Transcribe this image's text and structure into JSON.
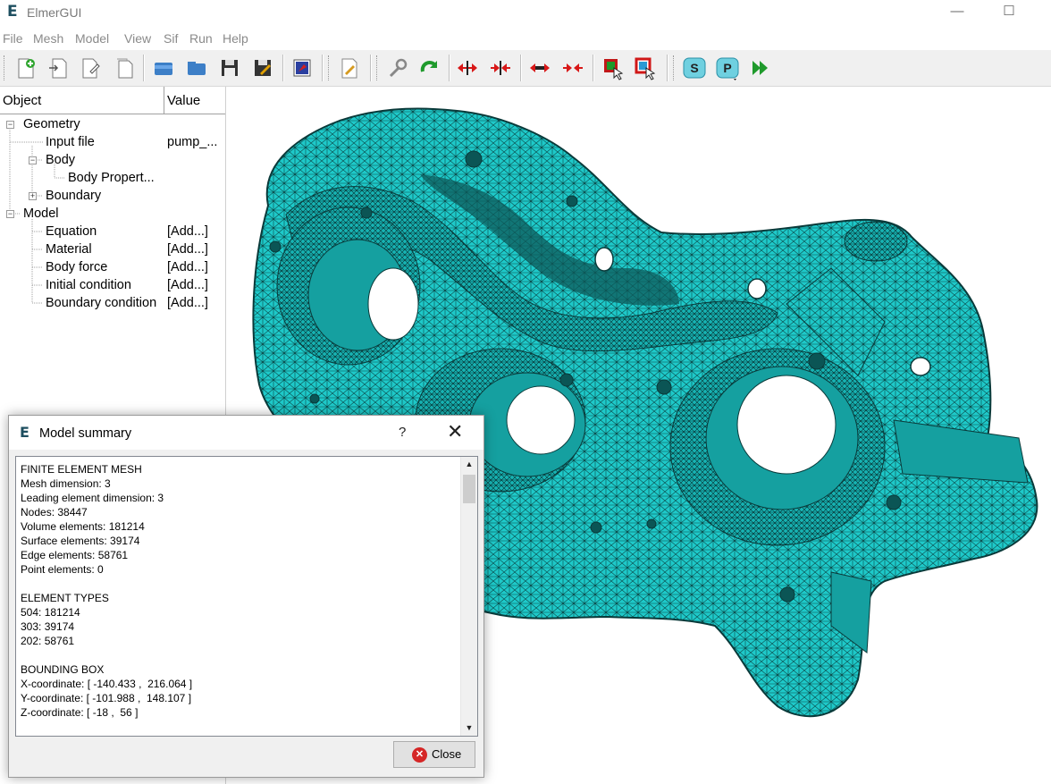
{
  "window": {
    "title": "ElmerGUI",
    "logo": "E",
    "controls": [
      "minimize-icon",
      "maximize-icon"
    ]
  },
  "menu": [
    "File",
    "Mesh",
    "Model",
    "View",
    "Sif",
    "Run",
    "Help"
  ],
  "toolbar_icons": [
    "new-icon",
    "open-icon",
    "edit-icon",
    "blank-page-icon",
    "folder-open-icon",
    "folder-icon",
    "save-icon",
    "save-as-icon",
    "view-icon",
    "edit-sif-icon",
    "wrench-icon",
    "reload-icon",
    "divide-icon",
    "unify-icon",
    "divide-edge-icon",
    "unify-edge-icon",
    "select-surface-icon",
    "select-edge-icon",
    "solver-s-icon",
    "postprocessor-p-icon",
    "run-icon"
  ],
  "tree": {
    "headers": {
      "object": "Object",
      "value": "Value"
    },
    "rows": [
      {
        "label": "Geometry",
        "value": ""
      },
      {
        "label": "Input file",
        "value": "pump_..."
      },
      {
        "label": "Body",
        "value": ""
      },
      {
        "label": "Body Propert...",
        "value": ""
      },
      {
        "label": "Boundary",
        "value": ""
      },
      {
        "label": "Model",
        "value": ""
      },
      {
        "label": "Equation",
        "value": "[Add...]"
      },
      {
        "label": "Material",
        "value": "[Add...]"
      },
      {
        "label": "Body force",
        "value": "[Add...]"
      },
      {
        "label": "Initial condition",
        "value": "[Add...]"
      },
      {
        "label": "Boundary condition",
        "value": "[Add...]"
      }
    ]
  },
  "mesh_colors": {
    "fill": "#1ec9c9",
    "edge": "#0a3a3a"
  },
  "dialog": {
    "title": "Model summary",
    "logo": "E",
    "help": "?",
    "close_x": "✕",
    "lines": [
      "FINITE ELEMENT MESH",
      "Mesh dimension: 3",
      "Leading element dimension: 3",
      "Nodes: 38447",
      "Volume elements: 181214",
      "Surface elements: 39174",
      "Edge elements: 58761",
      "Point elements: 0",
      "",
      "ELEMENT TYPES",
      "504: 181214",
      "303: 39174",
      "202: 58761",
      "",
      "BOUNDING BOX",
      "X-coordinate: [ -140.433 ,  216.064 ]",
      "Y-coordinate: [ -101.988 ,  148.107 ]",
      "Z-coordinate: [ -18 ,  56 ]"
    ],
    "close_button": "Close"
  }
}
